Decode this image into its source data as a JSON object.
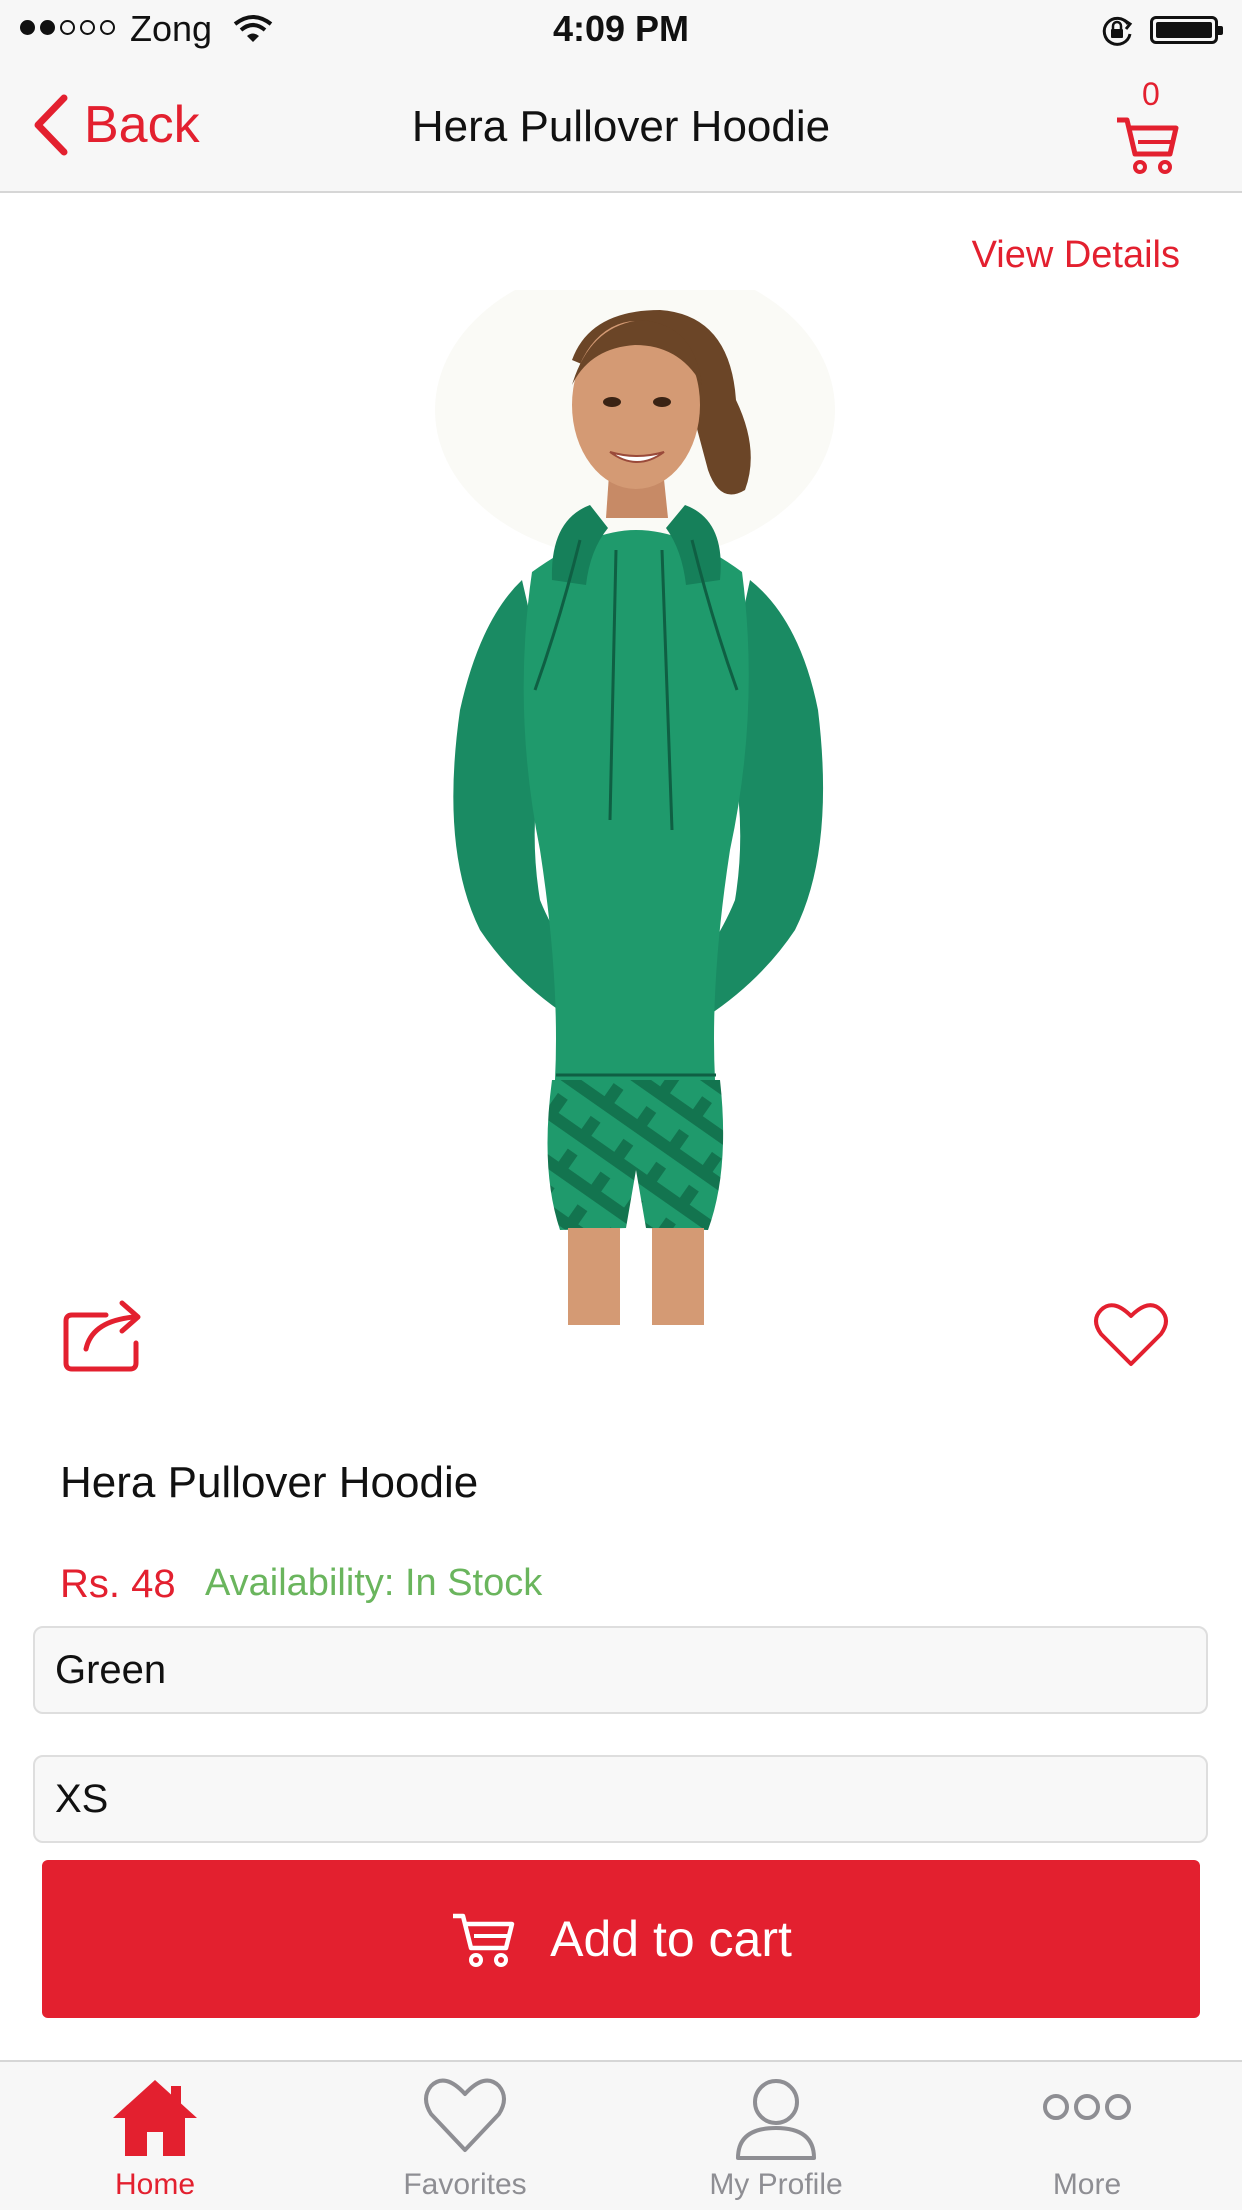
{
  "status_bar": {
    "carrier": "Zong",
    "time": "4:09 PM",
    "signal_bars_filled": 2,
    "signal_bars_total": 5
  },
  "nav": {
    "back_label": "Back",
    "title": "Hera Pullover Hoodie",
    "cart_count": "0"
  },
  "product": {
    "view_details_label": "View Details",
    "name": "Hera Pullover Hoodie",
    "price": "Rs. 48",
    "availability": "Availability: In Stock",
    "color_value": "Green",
    "size_value": "XS",
    "add_to_cart_label": "Add to cart"
  },
  "tabs": [
    {
      "label": "Home",
      "icon": "home-icon",
      "active": true
    },
    {
      "label": "Favorites",
      "icon": "heart-icon",
      "active": false
    },
    {
      "label": "My Profile",
      "icon": "user-icon",
      "active": false
    },
    {
      "label": "More",
      "icon": "more-icon",
      "active": false
    }
  ],
  "colors": {
    "accent": "#e3202f",
    "in_stock": "#6ab55d",
    "hoodie_green": "#1b8a62",
    "tab_inactive": "#8e8e93"
  }
}
